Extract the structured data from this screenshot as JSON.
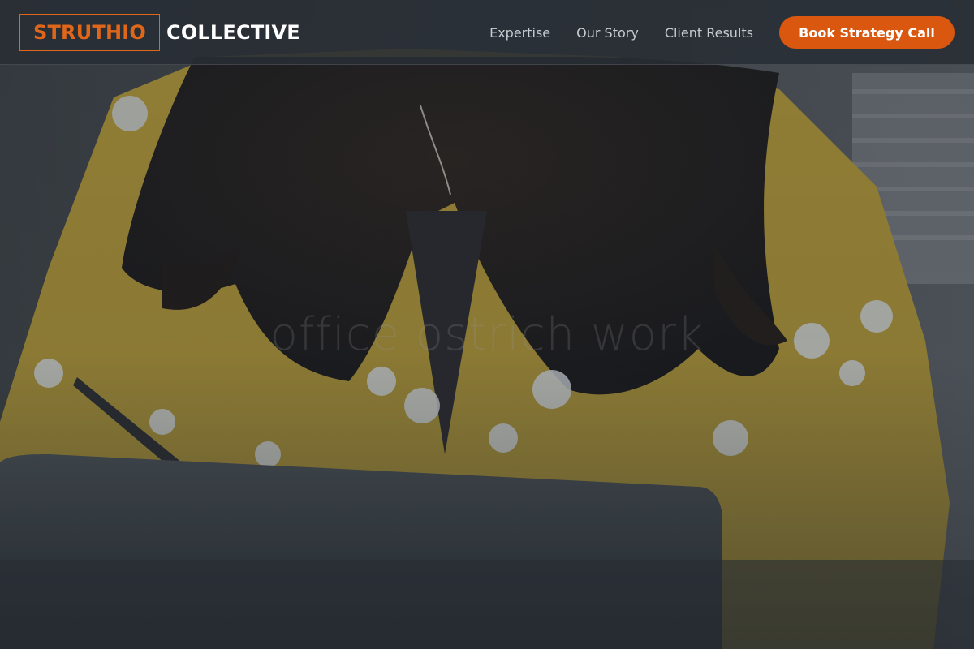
{
  "brand": {
    "name_part1": "STRUTHIO",
    "name_part2": "COLLECTIVE",
    "accent_color": "#e0661a"
  },
  "nav": {
    "links": [
      "Expertise",
      "Our Story",
      "Client Results"
    ],
    "cta_label": "Book Strategy Call",
    "cta_color": "#d9570f"
  },
  "hero": {
    "image_alt_text": "office ostrich work"
  }
}
